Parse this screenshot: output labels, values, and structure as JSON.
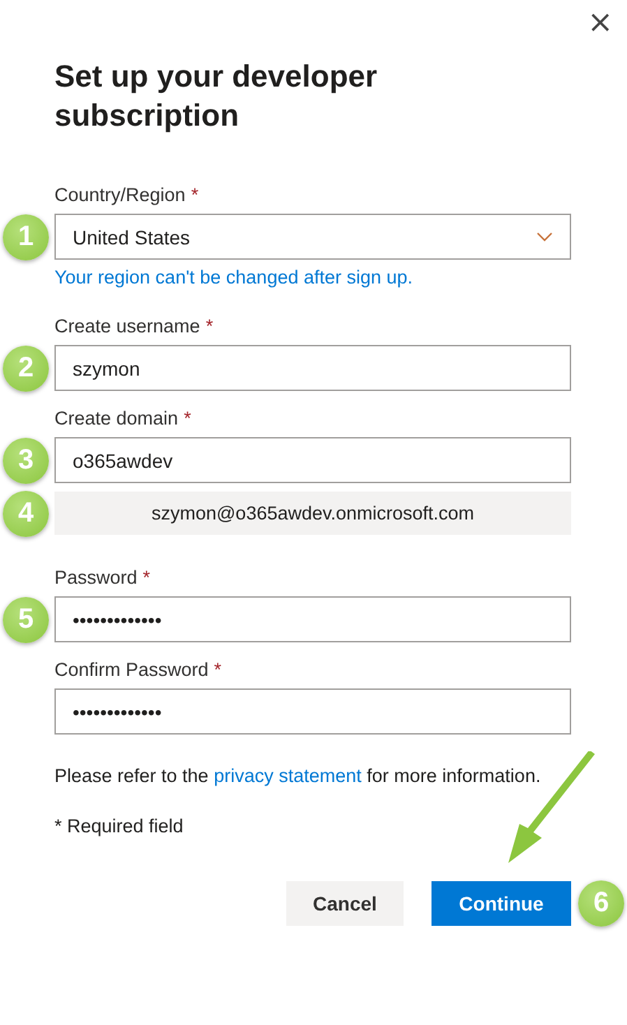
{
  "dialog": {
    "close": "×",
    "title": "Set up your developer subscription"
  },
  "fields": [
    {
      "kind": "select",
      "label": "Country/Region",
      "required_mark": "*",
      "value": "United States",
      "hint": "Your region can't be changed after sign up.",
      "badge": "1"
    },
    {
      "kind": "text",
      "label": "Create username",
      "required_mark": "*",
      "value": "szymon",
      "badge": "2"
    },
    {
      "kind": "text",
      "label": "Create domain",
      "required_mark": "*",
      "value": "o365awdev",
      "badge": "3"
    },
    {
      "kind": "preview",
      "value": "szymon@o365awdev.onmicrosoft.com",
      "badge": "4"
    },
    {
      "kind": "password",
      "label": "Password",
      "required_mark": "*",
      "value": "•••••••••••••",
      "badge": "5"
    },
    {
      "kind": "password",
      "label": "Confirm Password",
      "required_mark": "*",
      "value": "•••••••••••••"
    }
  ],
  "privacy": {
    "before": "Please refer to the",
    "link": "privacy statement",
    "after": "for more information."
  },
  "required_note": "* Required field",
  "buttons": [
    {
      "label": "Cancel",
      "kind": "secondary"
    },
    {
      "label": "Continue",
      "kind": "primary",
      "badge": "6"
    }
  ]
}
